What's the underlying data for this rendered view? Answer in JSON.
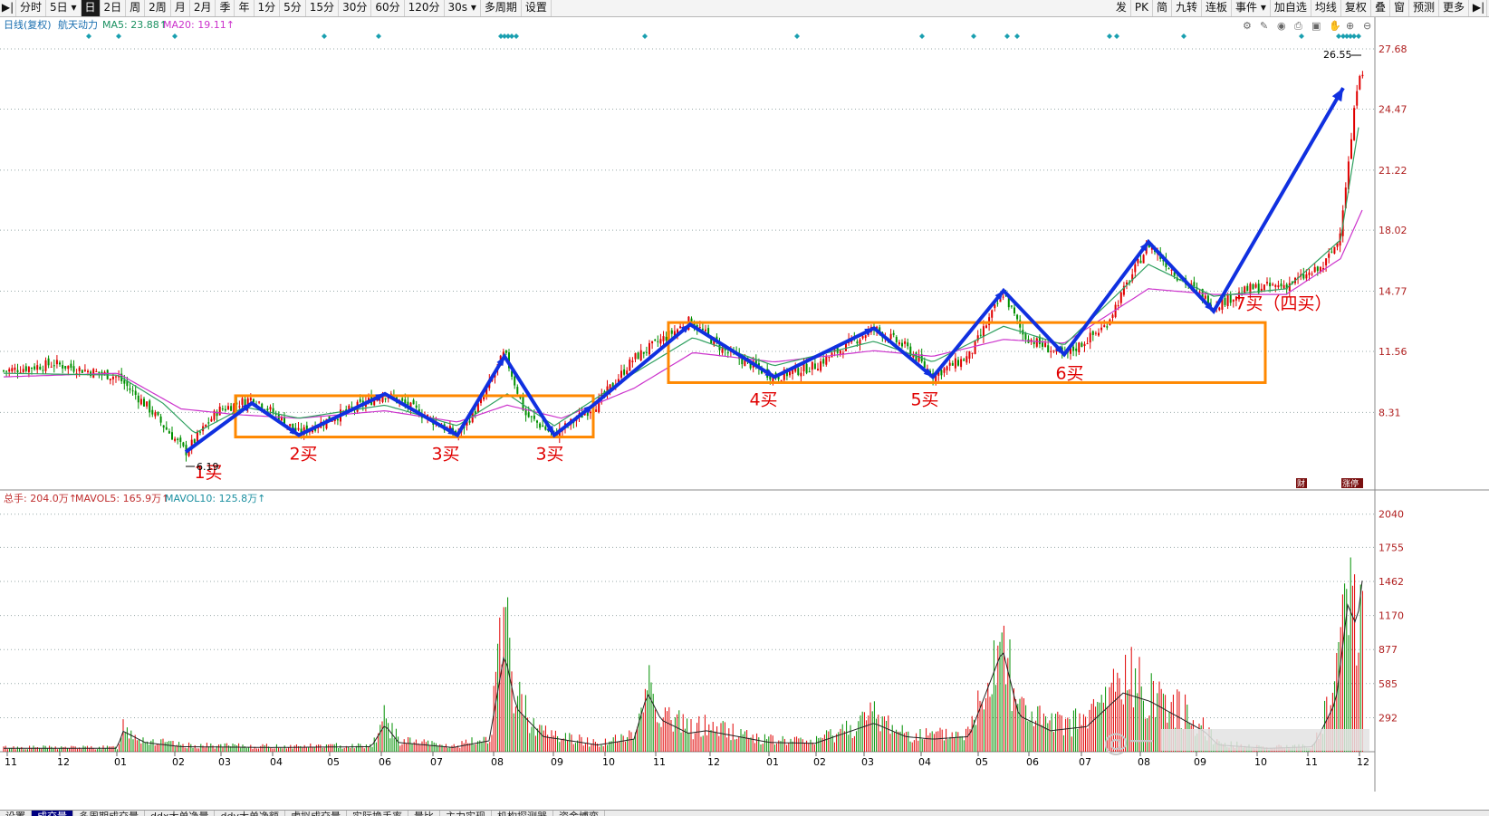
{
  "toolbar": {
    "left_items": [
      {
        "label": "分时",
        "active": false
      },
      {
        "label": "5日 ▾",
        "active": false
      },
      {
        "label": "日",
        "active": true
      },
      {
        "label": "2日",
        "active": false
      },
      {
        "label": "周",
        "active": false
      },
      {
        "label": "2周",
        "active": false
      },
      {
        "label": "月",
        "active": false
      },
      {
        "label": "2月",
        "active": false
      },
      {
        "label": "季",
        "active": false
      },
      {
        "label": "年",
        "active": false
      },
      {
        "label": "1分",
        "active": false
      },
      {
        "label": "5分",
        "active": false
      },
      {
        "label": "15分",
        "active": false
      },
      {
        "label": "30分",
        "active": false
      },
      {
        "label": "60分",
        "active": false
      },
      {
        "label": "120分",
        "active": false
      },
      {
        "label": "30s ▾",
        "active": false
      },
      {
        "label": "多周期",
        "active": false
      },
      {
        "label": "设置",
        "active": false
      }
    ],
    "right_items": [
      "发",
      "PK",
      "简",
      "九转",
      "连板",
      "事件 ▾",
      "加自选",
      "均线",
      "复权",
      "叠",
      "窗",
      "预测",
      "更多"
    ]
  },
  "price_panel": {
    "title": "日线(复权)",
    "stock_name": "航天动力",
    "ma5_label": "MA5: 23.88↑",
    "ma20_label": "MA20: 19.11↑",
    "y_ticks": [
      "27.68",
      "24.47",
      "21.22",
      "18.02",
      "14.77",
      "11.56",
      "8.31"
    ],
    "high_label": "26.55",
    "low_label": "6.19",
    "icon_cai": "财",
    "icon_zhang": "涨停"
  },
  "volume_panel": {
    "total_label": "总手: 204.0万↑",
    "mavol5_label": "MAVOL5: 165.9万↑",
    "mavol10_label": "MAVOL10: 125.8万↑",
    "y_ticks": [
      "2040",
      "1755",
      "1462",
      "1170",
      "877",
      "585",
      "292"
    ]
  },
  "x_axis": {
    "months": [
      "11",
      "12",
      "01",
      "02",
      "03",
      "04",
      "05",
      "06",
      "07",
      "08",
      "09",
      "10",
      "11",
      "12",
      "01",
      "02",
      "03",
      "04",
      "05",
      "06",
      "07",
      "08",
      "09",
      "10",
      "11",
      "12"
    ]
  },
  "annotations": {
    "buy_labels": [
      "1买",
      "2买",
      "3买",
      "3买",
      "4买",
      "5买",
      "6买",
      "7买（四买）"
    ]
  },
  "watermark": "@一",
  "bottom_tabs": [
    "设置",
    "成交量",
    "多周期成交量",
    "ddx大单净量",
    "ddy大单净额",
    "虚拟成交量",
    "实际换手率",
    "量比",
    "主力实现",
    "机构探测器",
    "资金博弈"
  ],
  "colors": {
    "up": "#e00000",
    "down": "#009000",
    "ma5": "#30a060",
    "ma20": "#cc33cc",
    "arrow": "#1030e0",
    "box": "#ff8800",
    "label": "#e00000",
    "diamond": "#1a9fb0"
  },
  "chart_data": {
    "type": "candlestick",
    "price_ylim": [
      5,
      28.5
    ],
    "volume_ylim": [
      0,
      2100
    ],
    "price_path": [
      [
        0,
        10.5
      ],
      [
        60,
        10.9
      ],
      [
        130,
        10.2
      ],
      [
        165,
        8.5
      ],
      [
        205,
        6.2
      ],
      [
        240,
        8.4
      ],
      [
        280,
        9.1
      ],
      [
        330,
        7.2
      ],
      [
        380,
        8.3
      ],
      [
        425,
        9.3
      ],
      [
        460,
        8.4
      ],
      [
        505,
        7.1
      ],
      [
        530,
        8.8
      ],
      [
        557,
        11.5
      ],
      [
        580,
        8.2
      ],
      [
        612,
        7.1
      ],
      [
        660,
        8.8
      ],
      [
        700,
        11.2
      ],
      [
        762,
        13.2
      ],
      [
        800,
        11.6
      ],
      [
        855,
        10.2
      ],
      [
        900,
        10.8
      ],
      [
        965,
        12.8
      ],
      [
        1000,
        11.8
      ],
      [
        1030,
        10.3
      ],
      [
        1070,
        11.3
      ],
      [
        1108,
        14.7
      ],
      [
        1130,
        12.4
      ],
      [
        1175,
        11.3
      ],
      [
        1220,
        12.9
      ],
      [
        1268,
        17.3
      ],
      [
        1300,
        15.6
      ],
      [
        1340,
        14.0
      ],
      [
        1380,
        14.9
      ],
      [
        1420,
        15.1
      ],
      [
        1460,
        16.0
      ],
      [
        1478,
        17.5
      ],
      [
        1490,
        22.0
      ],
      [
        1500,
        26.5
      ]
    ],
    "volume_path": [
      [
        0,
        40
      ],
      [
        130,
        40
      ],
      [
        135,
        250
      ],
      [
        160,
        110
      ],
      [
        200,
        60
      ],
      [
        300,
        50
      ],
      [
        410,
        60
      ],
      [
        425,
        320
      ],
      [
        440,
        110
      ],
      [
        500,
        50
      ],
      [
        540,
        130
      ],
      [
        557,
        1180
      ],
      [
        570,
        520
      ],
      [
        600,
        180
      ],
      [
        660,
        80
      ],
      [
        700,
        150
      ],
      [
        715,
        700
      ],
      [
        730,
        380
      ],
      [
        760,
        220
      ],
      [
        780,
        250
      ],
      [
        850,
        110
      ],
      [
        900,
        100
      ],
      [
        965,
        340
      ],
      [
        1000,
        180
      ],
      [
        1030,
        150
      ],
      [
        1070,
        180
      ],
      [
        1107,
        1220
      ],
      [
        1125,
        430
      ],
      [
        1160,
        250
      ],
      [
        1200,
        300
      ],
      [
        1240,
        700
      ],
      [
        1270,
        600
      ],
      [
        1300,
        420
      ],
      [
        1330,
        240
      ],
      [
        1345,
        80
      ],
      [
        1400,
        40
      ],
      [
        1450,
        60
      ],
      [
        1475,
        600
      ],
      [
        1488,
        1750
      ],
      [
        1498,
        1500
      ],
      [
        1504,
        2040
      ]
    ],
    "ma5": [
      [
        0,
        10.4
      ],
      [
        130,
        10.3
      ],
      [
        180,
        8.8
      ],
      [
        215,
        7.2
      ],
      [
        270,
        8.6
      ],
      [
        330,
        8.0
      ],
      [
        425,
        8.7
      ],
      [
        505,
        7.6
      ],
      [
        560,
        9.3
      ],
      [
        612,
        7.6
      ],
      [
        700,
        10.4
      ],
      [
        765,
        12.3
      ],
      [
        855,
        10.8
      ],
      [
        965,
        12.1
      ],
      [
        1030,
        11.0
      ],
      [
        1108,
        12.9
      ],
      [
        1175,
        11.9
      ],
      [
        1268,
        16.2
      ],
      [
        1340,
        14.5
      ],
      [
        1420,
        14.9
      ],
      [
        1480,
        17.5
      ],
      [
        1500,
        23.5
      ]
    ],
    "ma20": [
      [
        0,
        10.2
      ],
      [
        130,
        10.4
      ],
      [
        200,
        8.5
      ],
      [
        260,
        8.2
      ],
      [
        330,
        8.0
      ],
      [
        425,
        8.4
      ],
      [
        505,
        7.8
      ],
      [
        560,
        8.7
      ],
      [
        620,
        8.0
      ],
      [
        700,
        9.6
      ],
      [
        765,
        11.5
      ],
      [
        855,
        11.0
      ],
      [
        965,
        11.6
      ],
      [
        1030,
        11.3
      ],
      [
        1108,
        12.2
      ],
      [
        1175,
        12.0
      ],
      [
        1268,
        14.9
      ],
      [
        1340,
        14.6
      ],
      [
        1420,
        14.6
      ],
      [
        1480,
        16.5
      ],
      [
        1505,
        19.2
      ]
    ],
    "arrow_path": [
      [
        205,
        6.2
      ],
      [
        278,
        8.8
      ],
      [
        330,
        7.1
      ],
      [
        425,
        9.3
      ],
      [
        505,
        7.1
      ],
      [
        557,
        11.3
      ],
      [
        612,
        7.1
      ],
      [
        655,
        8.7
      ],
      [
        762,
        13.0
      ],
      [
        855,
        10.2
      ],
      [
        965,
        12.8
      ],
      [
        1030,
        10.2
      ],
      [
        1108,
        14.8
      ],
      [
        1175,
        11.4
      ],
      [
        1268,
        17.4
      ],
      [
        1340,
        13.7
      ],
      [
        1483,
        25.6
      ]
    ],
    "boxes": [
      {
        "x1": 260,
        "x2": 655,
        "y_low": 7.0,
        "y_high": 9.2
      },
      {
        "x1": 738,
        "x2": 1397,
        "y_low": 9.9,
        "y_high": 13.1
      }
    ],
    "buy_points": [
      {
        "x": 230,
        "price": 4.8
      },
      {
        "x": 335,
        "price": 5.8
      },
      {
        "x": 492,
        "price": 5.8
      },
      {
        "x": 607,
        "price": 5.8
      },
      {
        "x": 843,
        "price": 8.7
      },
      {
        "x": 1021,
        "price": 8.7
      },
      {
        "x": 1181,
        "price": 10.1
      },
      {
        "x": 1417,
        "price": 13.8
      }
    ],
    "diamonds": [
      98,
      131,
      193,
      358,
      418,
      553,
      557,
      561,
      565,
      570,
      712,
      880,
      1018,
      1075,
      1112,
      1123,
      1225,
      1233,
      1307,
      1437,
      1478,
      1483,
      1487,
      1491,
      1495,
      1500
    ]
  }
}
